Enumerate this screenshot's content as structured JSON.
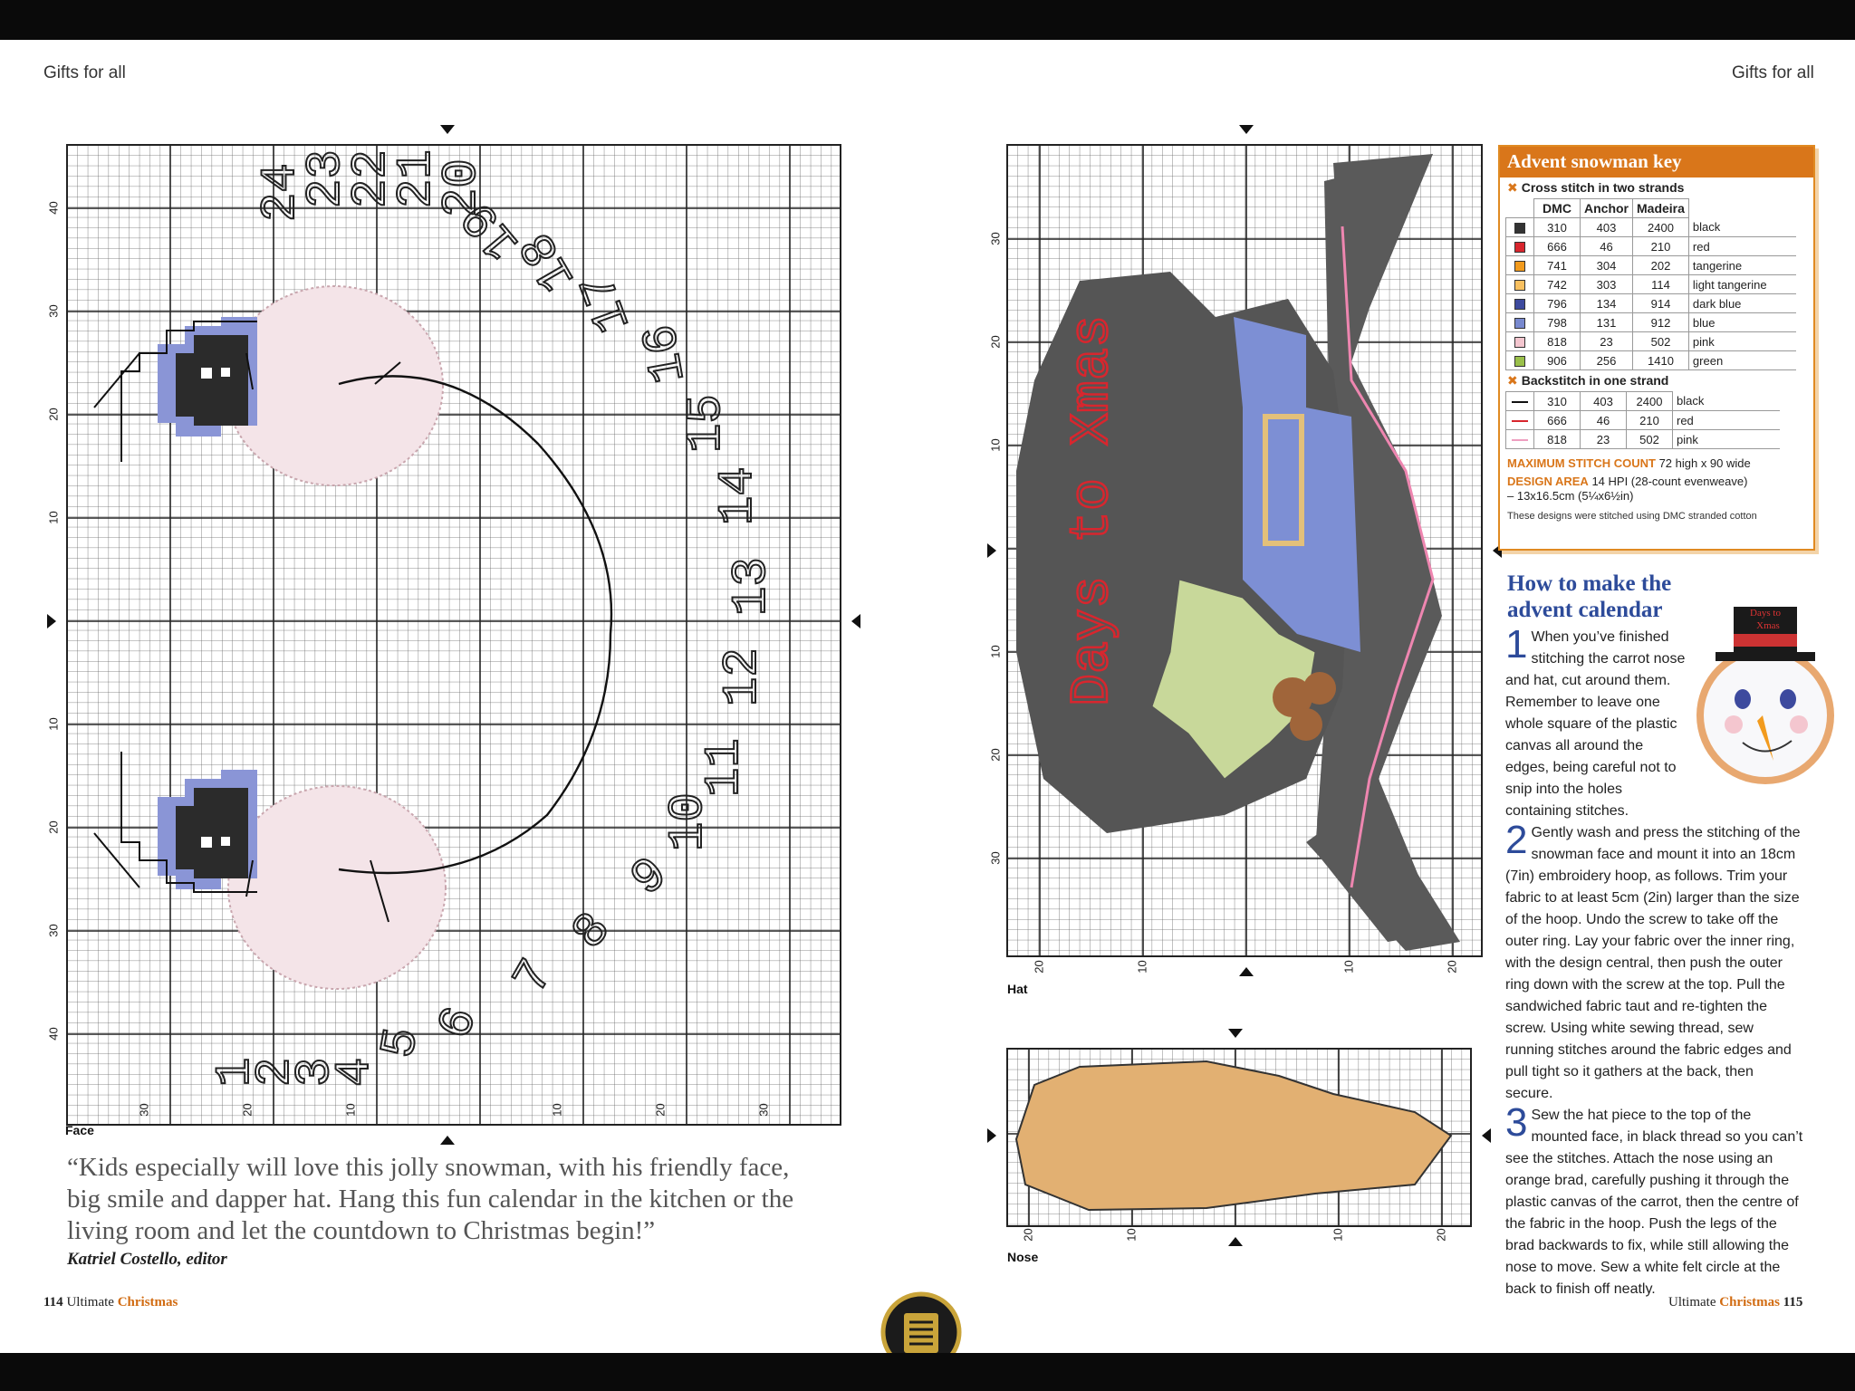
{
  "header": {
    "left_section": "Gifts for all",
    "right_section": "Gifts for all"
  },
  "face_chart": {
    "caption": "Face",
    "left_axis": [
      "40",
      "30",
      "20",
      "10",
      "10",
      "20",
      "30",
      "40"
    ],
    "bottom_axis": [
      "30",
      "20",
      "10",
      "10",
      "20",
      "30"
    ],
    "numbers": [
      "1",
      "2",
      "3",
      "4",
      "5",
      "6",
      "7",
      "8",
      "9",
      "10",
      "11",
      "12",
      "13",
      "14",
      "15",
      "16",
      "17",
      "18",
      "19",
      "20",
      "21",
      "22",
      "23",
      "24"
    ]
  },
  "hat_chart": {
    "caption": "Hat",
    "left_axis": [
      "30",
      "20",
      "10",
      "10",
      "20",
      "30"
    ],
    "bottom_axis": [
      "20",
      "10",
      "10",
      "20"
    ],
    "text_stitched": "Days to Xmas"
  },
  "nose_chart": {
    "caption": "Nose",
    "bottom_axis": [
      "20",
      "10",
      "10",
      "20"
    ]
  },
  "quote": {
    "text": "“Kids especially will love this jolly snowman, with his friendly face, big smile and dapper hat. Hang this fun calendar in the kitchen or the living room and let the countdown to Christmas begin!”",
    "author": "Katriel Costello, editor"
  },
  "folio": {
    "left_number": "114",
    "left_pub": "Ultimate",
    "left_word": "Christmas",
    "right_pub": "Ultimate",
    "right_word": "Christmas",
    "right_number": "115"
  },
  "key": {
    "title": "Advent snowman key",
    "cross_heading": "Cross stitch in two strands",
    "columns": [
      "DMC",
      "Anchor",
      "Madeira"
    ],
    "cross": [
      {
        "dmc": "310",
        "anchor": "403",
        "madeira": "2400",
        "name": "black",
        "color": "#333333"
      },
      {
        "dmc": "666",
        "anchor": "46",
        "madeira": "210",
        "name": "red",
        "color": "#d8262e"
      },
      {
        "dmc": "741",
        "anchor": "304",
        "madeira": "202",
        "name": "tangerine",
        "color": "#f29b1e"
      },
      {
        "dmc": "742",
        "anchor": "303",
        "madeira": "114",
        "name": "light tangerine",
        "color": "#f8c060"
      },
      {
        "dmc": "796",
        "anchor": "134",
        "madeira": "914",
        "name": "dark blue",
        "color": "#3d4a9e"
      },
      {
        "dmc": "798",
        "anchor": "131",
        "madeira": "912",
        "name": "blue",
        "color": "#7889cf"
      },
      {
        "dmc": "818",
        "anchor": "23",
        "madeira": "502",
        "name": "pink",
        "color": "#f4c6cf"
      },
      {
        "dmc": "906",
        "anchor": "256",
        "madeira": "1410",
        "name": "green",
        "color": "#9ac04a"
      }
    ],
    "back_heading": "Backstitch in one strand",
    "back": [
      {
        "dmc": "310",
        "anchor": "403",
        "madeira": "2400",
        "name": "black",
        "color": "#111111"
      },
      {
        "dmc": "666",
        "anchor": "46",
        "madeira": "210",
        "name": "red",
        "color": "#d8262e"
      },
      {
        "dmc": "818",
        "anchor": "23",
        "madeira": "502",
        "name": "pink",
        "color": "#ee9fc0"
      }
    ],
    "count_label": "MAXIMUM STITCH COUNT",
    "count_value": "72 high x 90 wide",
    "area_label": "DESIGN AREA",
    "area_value": "14 HPI (28-count evenweave)",
    "area_size": "– 13x16.5cm (5¼x6½in)",
    "note": "These designs were stitched using DMC stranded cotton"
  },
  "howto": {
    "title": "How to make the advent calendar",
    "steps": [
      {
        "n": "1",
        "text": "When you’ve finished stitching the carrot nose and hat, cut around them. Remember to leave one whole square of the plastic canvas all around the edges, being careful not to snip into the holes containing stitches."
      },
      {
        "n": "2",
        "text": "Gently wash and press the stitching of the snowman face and mount it into an 18cm (7in) embroidery hoop, as follows. Trim your fabric to at least 5cm (2in) larger than the size of the hoop. Undo the screw to take off the outer ring. Lay your fabric over the inner ring, with the design central, then push the outer ring down with the screw at the top. Pull the sandwiched fabric taut and re-tighten the screw. Using white sewing thread, sew running stitches around the fabric edges and pull tight so it gathers at the back, then secure."
      },
      {
        "n": "3",
        "text": "Sew the hat piece to the top of the mounted face, in black thread so you can’t see the stitches. Attach the nose using an orange brad, carefully pushing it through the plastic canvas of the carrot, then the centre of the fabric in the hoop. Push the legs of the brad backwards to fix, while still allowing the nose to move. Sew a white felt circle at the back to finish off neatly."
      }
    ]
  },
  "photo": {
    "hat_text_line1": "Days to",
    "hat_text_line2": "Xmas"
  },
  "colors": {
    "accent": "#d9761a",
    "title_blue": "#2d4b9a",
    "grid": "#555555",
    "hat_grey": "#5a5a5a",
    "nose_tan": "#e2b072"
  }
}
